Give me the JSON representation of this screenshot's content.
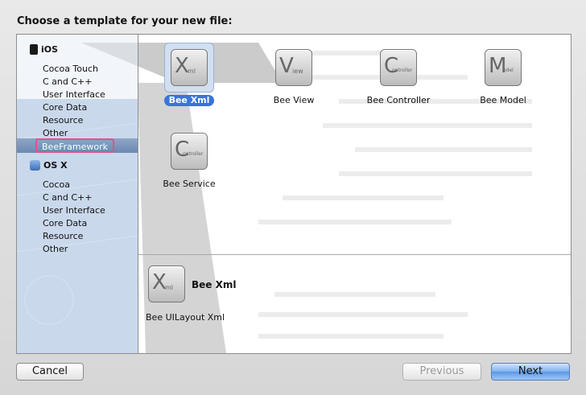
{
  "dialog": {
    "title": "Choose a template for your new file:"
  },
  "sidebar": {
    "groups": [
      {
        "label": "iOS",
        "icon": "iphone-icon",
        "items": [
          "Cocoa Touch",
          "C and C++",
          "User Interface",
          "Core Data",
          "Resource",
          "Other",
          "BeeFramework"
        ],
        "selected": "BeeFramework"
      },
      {
        "label": "OS X",
        "icon": "mac-finder-icon",
        "items": [
          "Cocoa",
          "C and C++",
          "User Interface",
          "Core Data",
          "Resource",
          "Other"
        ]
      }
    ]
  },
  "templates": [
    {
      "label": "Bee Xml",
      "glyph": "X",
      "sub": "ml",
      "selected": true
    },
    {
      "label": "Bee View",
      "glyph": "V",
      "sub": "iew"
    },
    {
      "label": "Bee Controller",
      "glyph": "C",
      "sub": "ontroller"
    },
    {
      "label": "Bee Model",
      "glyph": "M",
      "sub": "odel"
    },
    {
      "label": "Bee Service",
      "glyph": "C",
      "sub": "ontroller"
    }
  ],
  "detail": {
    "title": "Bee Xml",
    "glyph": "X",
    "sub": "ml",
    "description": "Bee UILayout Xml"
  },
  "buttons": {
    "cancel": "Cancel",
    "previous": "Previous",
    "next": "Next"
  },
  "colors": {
    "selection_blue": "#3875d7",
    "highlight_pink": "#e2508f"
  }
}
